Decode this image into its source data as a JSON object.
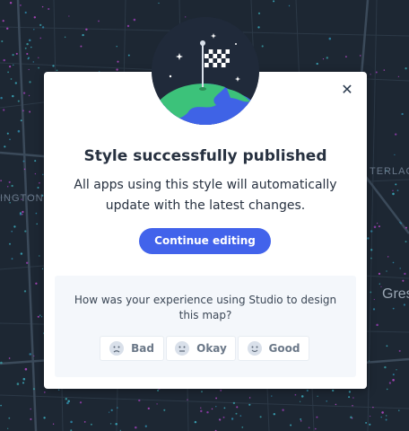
{
  "background": {
    "labels": [
      "INGTON",
      "TERLAC",
      "Gres"
    ]
  },
  "dialog": {
    "title": "Style successfully published",
    "description": "All apps using this style will automatically update with the latest changes.",
    "primary_button": "Continue editing",
    "close_icon": "close-icon",
    "illustration_icon": "flag-on-planet-icon"
  },
  "feedback": {
    "question": "How was your experience using Studio to design this map?",
    "options": [
      {
        "label": "Bad",
        "icon": "sad-face-icon"
      },
      {
        "label": "Okay",
        "icon": "neutral-face-icon"
      },
      {
        "label": "Good",
        "icon": "happy-face-icon"
      }
    ]
  },
  "colors": {
    "accent": "#4263eb",
    "map_bg": "#1d2733",
    "text": "#273140"
  }
}
